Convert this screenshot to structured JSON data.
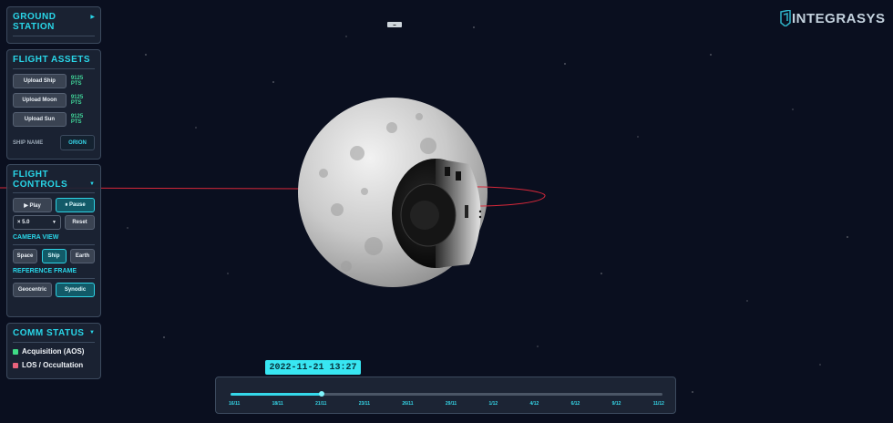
{
  "brand": {
    "name": "INTEGRASYS"
  },
  "ground_station": {
    "title_line1": "GROUND",
    "title_line2": "STATION"
  },
  "flight_assets": {
    "title": "FLIGHT ASSETS",
    "uploads": [
      {
        "label": "Upload Ship",
        "points": "9125 PTS"
      },
      {
        "label": "Upload Moon",
        "points": "9125 PTS"
      },
      {
        "label": "Upload Sun",
        "points": "9125 PTS"
      }
    ],
    "ship_name_label": "SHIP NAME",
    "ship_name_value": "ORION"
  },
  "flight_controls": {
    "title_line1": "FLIGHT",
    "title_line2": "CONTROLS",
    "play_label": "▶ Play",
    "pause_label": "⏸ Pause",
    "speed_value": "× 5.0",
    "reset_label": "Reset",
    "camera_view_label": "CAMERA VIEW",
    "camera_views": [
      "Space",
      "Ship",
      "Earth"
    ],
    "camera_selected": "Ship",
    "reference_frame_label": "REFERENCE FRAME",
    "reference_frames": [
      "Geocentric",
      "Synodic"
    ],
    "reference_selected": "Synodic"
  },
  "comm_status": {
    "title": "COMM STATUS",
    "items": [
      {
        "label": "Acquisition (AOS)",
        "color": "#3fdc86"
      },
      {
        "label": "LOS / Occultation",
        "color": "#e8637c"
      }
    ]
  },
  "timeline": {
    "current": "2022-11-21 13:27",
    "progress": 0.21,
    "ticks": [
      "16/11",
      "18/11",
      "21/11",
      "23/11",
      "26/11",
      "29/11",
      "1/12",
      "4/12",
      "6/12",
      "9/12",
      "11/12"
    ]
  },
  "colors": {
    "accent": "#29d6e8",
    "orbit": "#d8283a",
    "background": "#0a0f1f"
  }
}
